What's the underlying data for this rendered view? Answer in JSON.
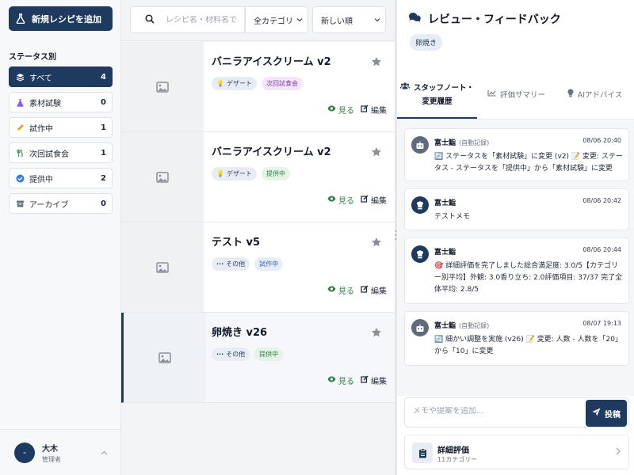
{
  "sidebar": {
    "new_recipe_label": "新規レシピを追加",
    "status_heading": "ステータス別",
    "statuses": [
      {
        "label": "すべて",
        "count": "4",
        "icon": "layers-icon"
      },
      {
        "label": "素材試験",
        "count": "0",
        "icon": "flask-icon"
      },
      {
        "label": "試作中",
        "count": "1",
        "icon": "pencil-icon"
      },
      {
        "label": "次回試食会",
        "count": "1",
        "icon": "utensils-icon"
      },
      {
        "label": "提供中",
        "count": "2",
        "icon": "check-circle-icon"
      },
      {
        "label": "アーカイブ",
        "count": "0",
        "icon": "archive-icon"
      }
    ],
    "user": {
      "avatar": "-",
      "name": "大木",
      "role": "管理者"
    }
  },
  "toolbar": {
    "search_placeholder": "レシピ名・材料名で",
    "category_selected": "全カテゴリ",
    "sort_selected": "新しい順"
  },
  "recipes": [
    {
      "title": "バニラアイスクリーム v2",
      "category": "デザート",
      "status": "次回試食会",
      "status_color": "#7e3ba8",
      "view": "見る",
      "edit": "編集"
    },
    {
      "title": "バニラアイスクリーム v2",
      "category": "デザート",
      "status": "提供中",
      "status_color": "#2f7d45",
      "view": "見る",
      "edit": "編集"
    },
    {
      "title": "テスト v5",
      "category": "その他",
      "status": "試作中",
      "status_color": "#2f5ea8",
      "view": "見る",
      "edit": "編集"
    },
    {
      "title": "卵焼き v26",
      "category": "その他",
      "status": "提供中",
      "status_color": "#2f7d45",
      "view": "見る",
      "edit": "編集"
    }
  ],
  "panel": {
    "title": "レビュー・フィードバック",
    "chip": "卵焼き",
    "tabs": [
      {
        "label_line1": "スタッフノート・",
        "label_line2": "変更履歴",
        "icon": "users-icon"
      },
      {
        "label": "評価サマリー",
        "icon": "chart-line-icon"
      },
      {
        "label": "AIアドバイス",
        "icon": "lightbulb-icon"
      }
    ],
    "notes": [
      {
        "author": "富士鮨",
        "auto": "(自動記録)",
        "time": "08/06 20:40",
        "body": "🔄 ステータスを「素材試験」に変更 (v2) 📝 変更: ステータス - ステータスを「提供中」から「素材試験」に変更"
      },
      {
        "author": "富士鮨",
        "auto": "",
        "time": "08/06 20:42",
        "body": "テストメモ"
      },
      {
        "author": "富士鮨",
        "auto": "",
        "time": "08/06 20:44",
        "body": "🎯 詳細評価を完了しました総合満足度: 3.0/5【カテゴリー別平均】外観: 3.0香り立ち: 2.0評価項目: 37/37 完了全体平均: 2.8/5"
      },
      {
        "author": "富士鮨",
        "auto": "(自動記録)",
        "time": "08/07 19:13",
        "body": "🔄 細かい調整を実施 (v26) 📝 変更: 人数 - 人数を「20」から「10」に変更"
      }
    ],
    "composer_placeholder": "メモや提案を追加...",
    "post_label": "投稿",
    "eval_title": "詳細評価",
    "eval_sub": "11カテゴリー"
  },
  "colors": {
    "primary": "#1e3a5f",
    "green": "#2f7d45",
    "purple": "#7e3ba8"
  }
}
